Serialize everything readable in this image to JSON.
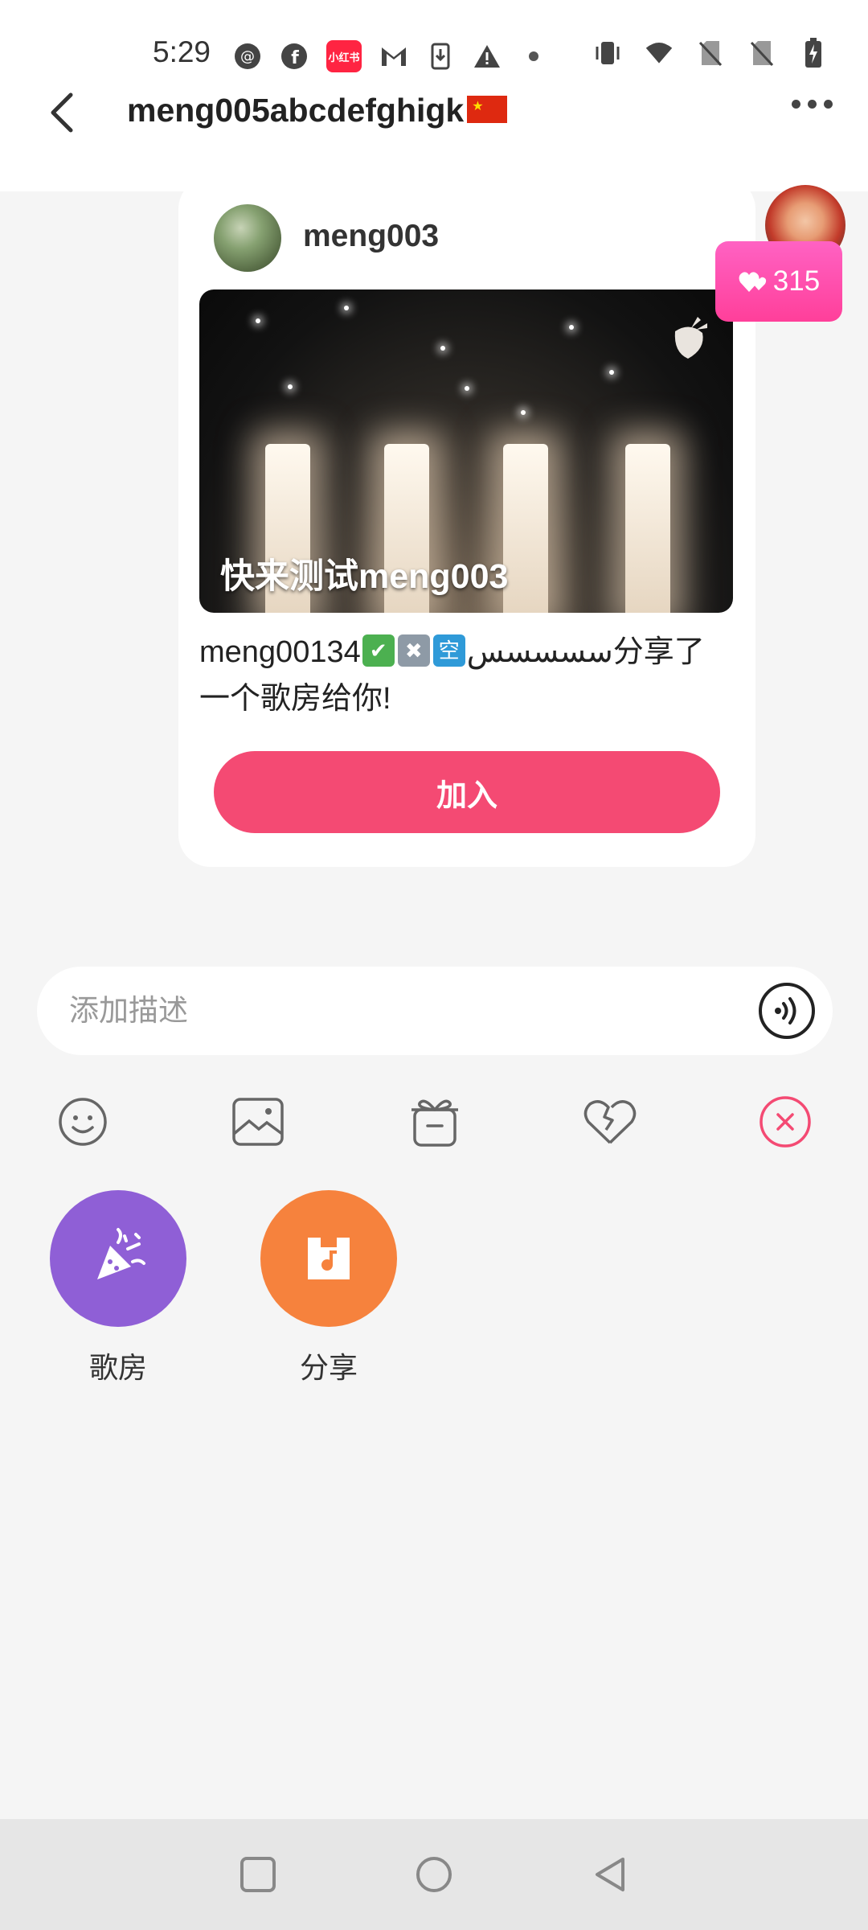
{
  "status_bar": {
    "time": "5:29",
    "left_icons": [
      "threads-icon",
      "facebook-icon",
      "xiaohongshu-icon",
      "gmail-icon",
      "download-icon",
      "warning-icon",
      "dot-icon"
    ],
    "xhs_text": "小红书",
    "right_icons": [
      "vibrate-icon",
      "wifi-icon",
      "no-sim-icon",
      "no-sim-icon",
      "battery-charging-icon"
    ]
  },
  "header": {
    "title": "meng005abcdefghigk"
  },
  "message": {
    "sender_name": "meng003",
    "cover_title": "快来测试meng003",
    "share_text_prefix": "meng001سسسسس",
    "emoji_1": "空",
    "emoji_2": "✖",
    "emoji_3": "✔",
    "share_text_suffix": "34分享了一个歌房给你!",
    "join_label": "加入",
    "likes_count": "315"
  },
  "input": {
    "placeholder": "添加描述",
    "value": ""
  },
  "toolbar": {
    "items": [
      "emoji-icon",
      "image-icon",
      "gift-icon",
      "heart-icon",
      "close-icon"
    ]
  },
  "apps": [
    {
      "label": "歌房",
      "icon": "party-icon",
      "color": "#8f5fd6"
    },
    {
      "label": "分享",
      "icon": "music-file-icon",
      "color": "#f6823d"
    }
  ],
  "colors": {
    "accent": "#f44a73",
    "likes_badge": "#ff4fae"
  }
}
